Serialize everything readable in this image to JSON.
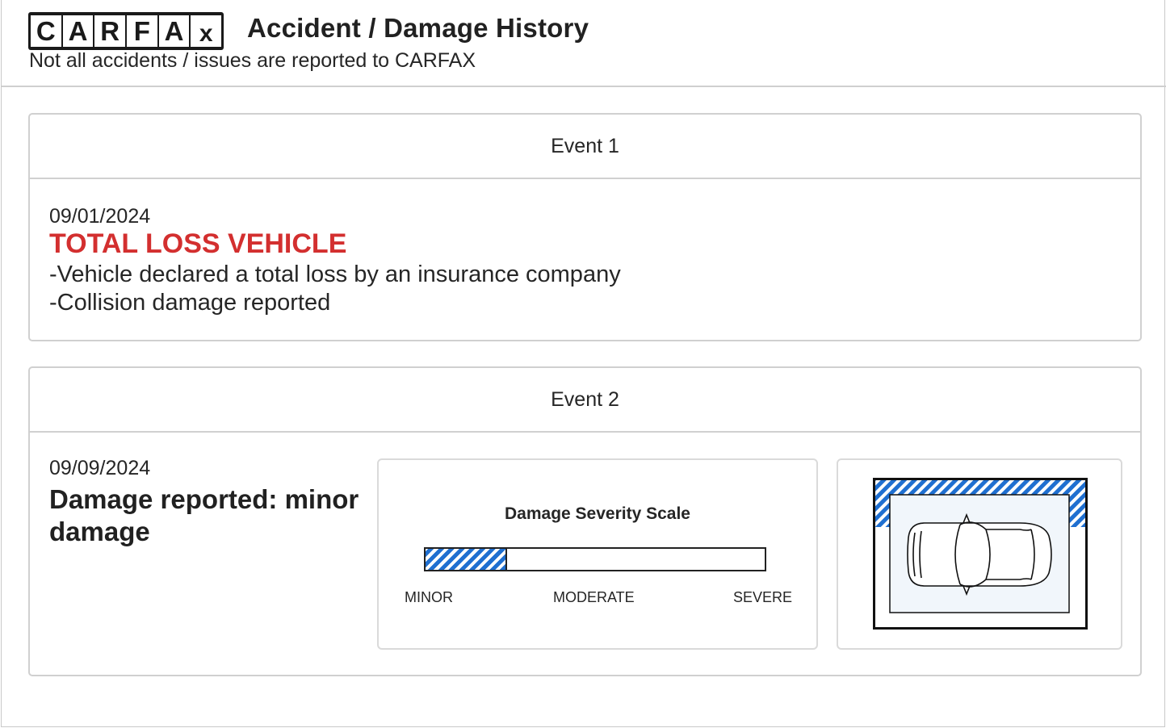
{
  "header": {
    "logo_letters": [
      "C",
      "A",
      "R",
      "F",
      "A",
      "x"
    ],
    "title": "Accident / Damage History",
    "subtitle": "Not all accidents / issues are reported to CARFAX"
  },
  "events": [
    {
      "label": "Event 1",
      "date": "09/01/2024",
      "headline": "TOTAL LOSS VEHICLE",
      "details": [
        "Vehicle declared a total loss by an insurance company",
        "Collision damage reported"
      ]
    },
    {
      "label": "Event 2",
      "date": "09/09/2024",
      "headline": "Damage reported: minor damage",
      "severity": {
        "title": "Damage Severity Scale",
        "labels": [
          "MINOR",
          "MODERATE",
          "SEVERE"
        ],
        "level_fraction": 0.24
      },
      "damage_location": "front"
    }
  ],
  "colors": {
    "accent_red": "#d32f2f",
    "damage_blue": "#1f6fd0",
    "border": "#d0d0d0"
  },
  "icons": [
    "car-top-view-icon"
  ]
}
